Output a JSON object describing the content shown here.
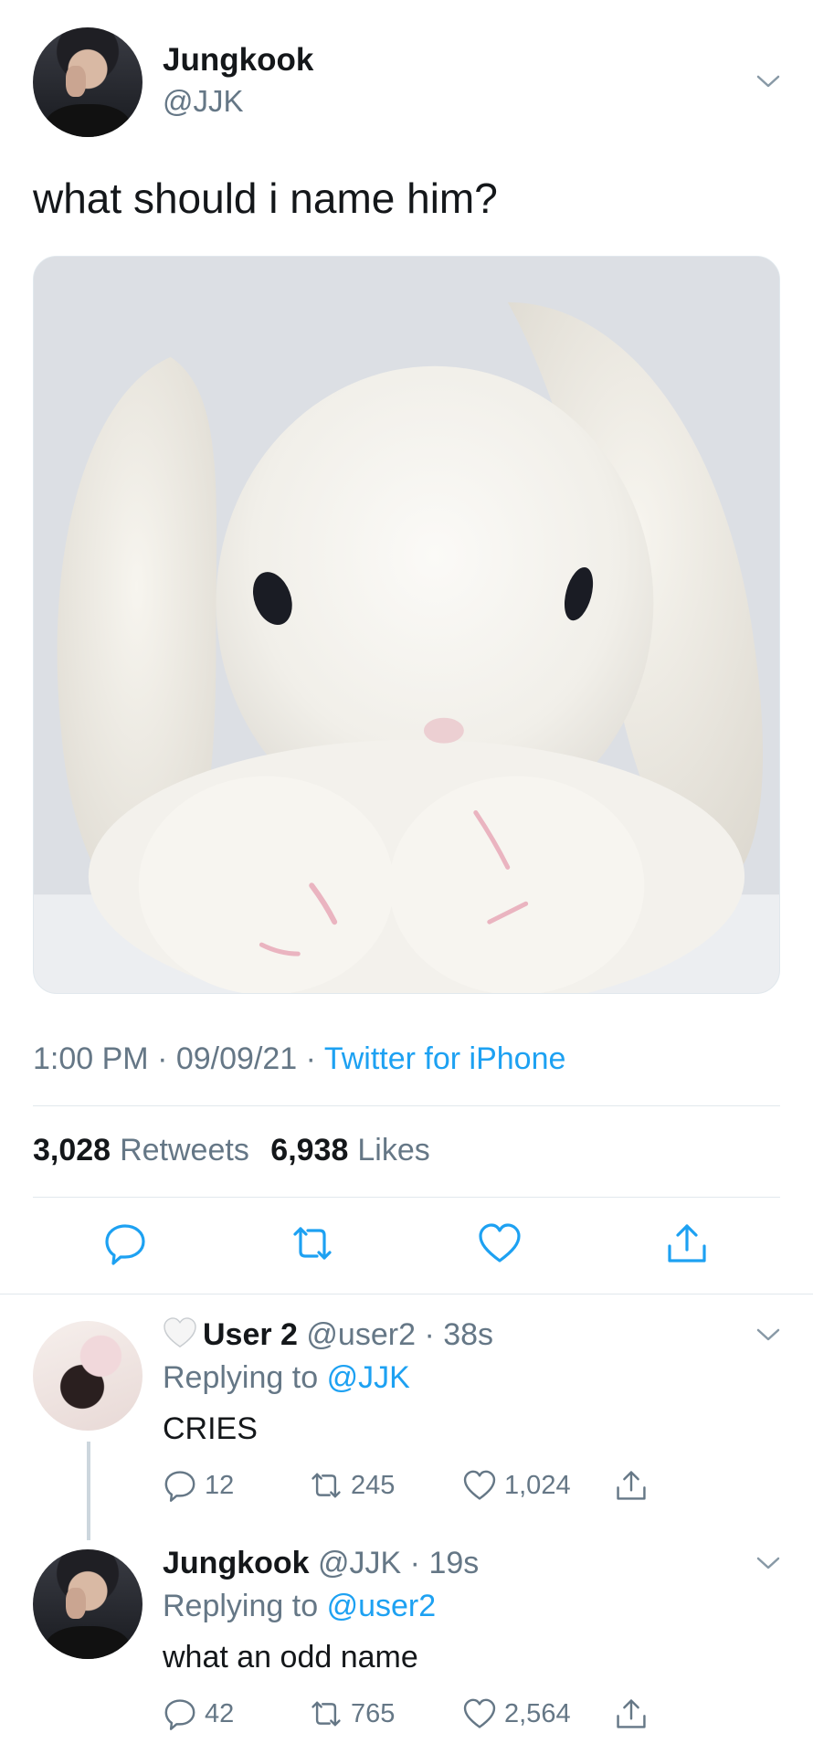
{
  "main_tweet": {
    "author_name": "Jungkook",
    "author_handle": "@JJK",
    "text": "what should i name him?",
    "time": "1:00 PM",
    "date": "09/09/21",
    "separator": "·",
    "source": "Twitter for iPhone",
    "retweets_count": "3,028",
    "retweets_label": "Retweets",
    "likes_count": "6,938",
    "likes_label": "Likes",
    "media_description_icon": "plush-bunny-photo"
  },
  "replies": [
    {
      "emoji_prefix_icon": "white-heart-icon",
      "author_name": "User 2",
      "author_handle": "@user2",
      "time": "38s",
      "replying_to_label": "Replying to",
      "replying_to_handle": "@JJK",
      "text": "CRIES",
      "reply_count": "12",
      "retweet_count": "245",
      "like_count": "1,024"
    },
    {
      "author_name": "Jungkook",
      "author_handle": "@JJK",
      "time": "19s",
      "replying_to_label": "Replying to",
      "replying_to_handle": "@user2",
      "text": "what an odd name",
      "reply_count": "42",
      "retweet_count": "765",
      "like_count": "2,564"
    }
  ],
  "colors": {
    "link": "#1da1f2",
    "secondary_text": "#657786",
    "primary_text": "#14171a",
    "divider": "#e1e8ed"
  }
}
